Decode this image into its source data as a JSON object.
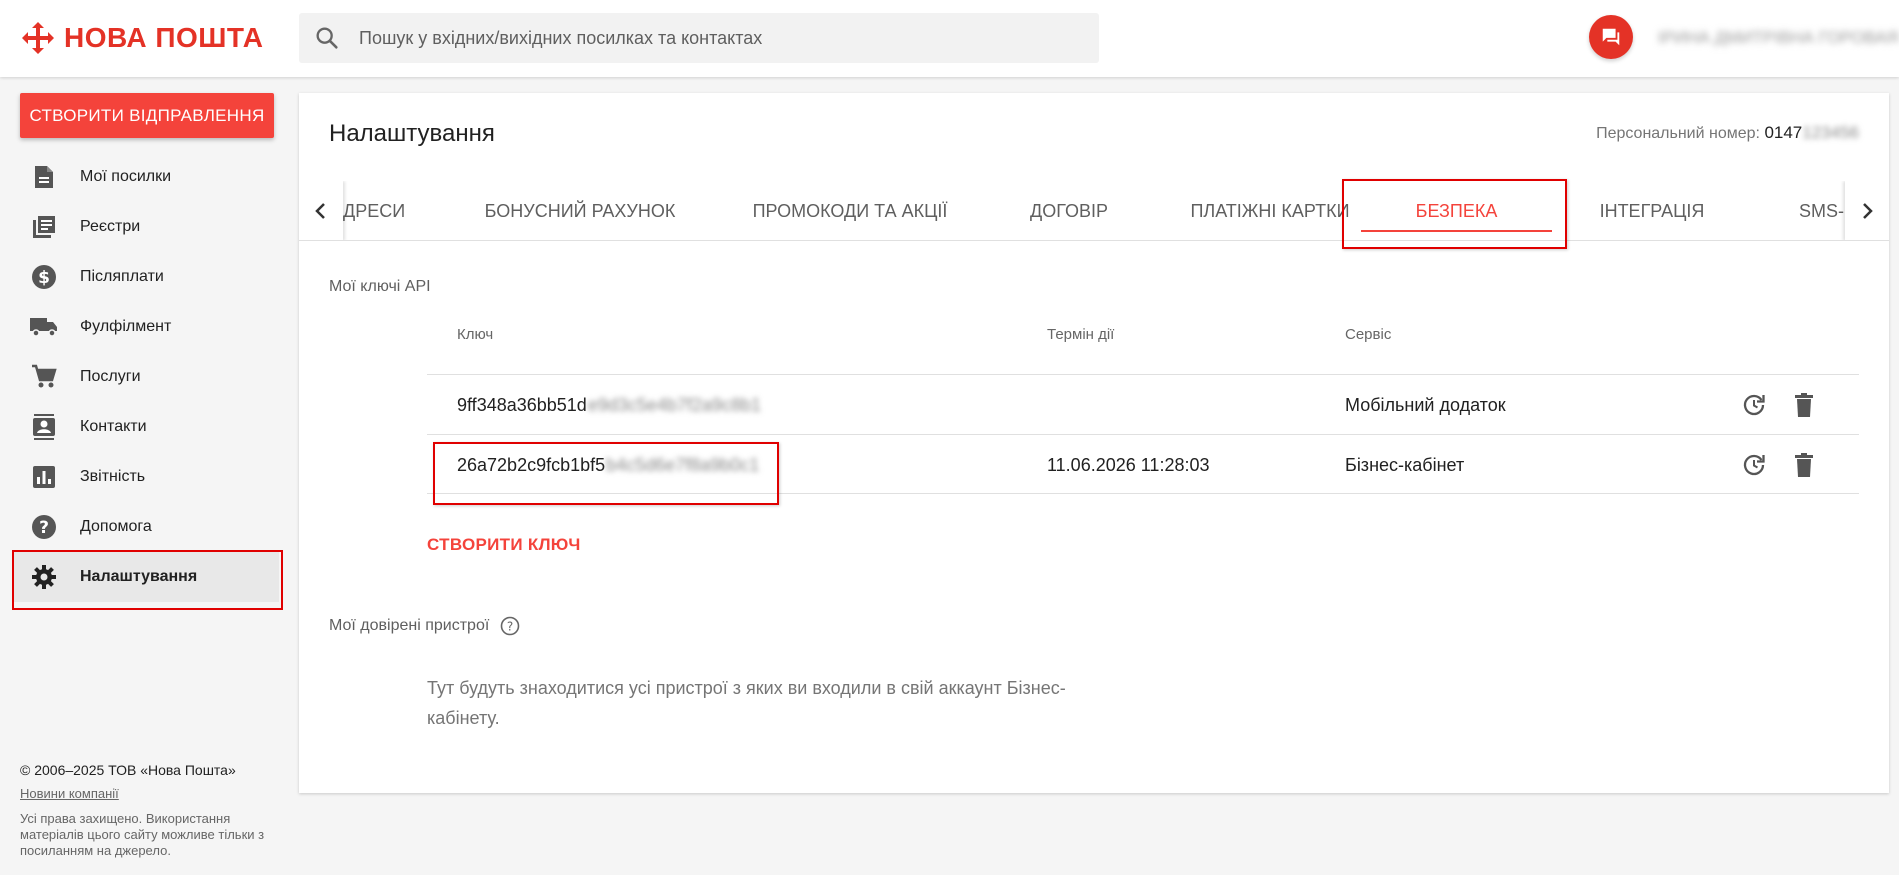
{
  "header": {
    "logo_text": "НОВА ПОШТА",
    "search_placeholder": "Пошук у вхідних/вихідних посилках та контактах",
    "user_name": "ІРИНА ДМИТРІВНА ГОРОВАЯ",
    "brand_color": "#e43226"
  },
  "sidebar": {
    "create_button": "СТВОРИТИ ВІДПРАВЛЕННЯ",
    "items": [
      {
        "label": "Мої посилки",
        "icon": "document-icon"
      },
      {
        "label": "Реєстри",
        "icon": "registry-icon"
      },
      {
        "label": "Післяплати",
        "icon": "dollar-icon"
      },
      {
        "label": "Фулфілмент",
        "icon": "truck-icon"
      },
      {
        "label": "Послуги",
        "icon": "cart-icon"
      },
      {
        "label": "Контакти",
        "icon": "contacts-icon"
      },
      {
        "label": "Звітність",
        "icon": "chart-icon"
      },
      {
        "label": "Допомога",
        "icon": "help-icon"
      },
      {
        "label": "Налаштування",
        "icon": "gear-icon",
        "active": true
      }
    ],
    "footer": {
      "copyright": "© 2006–2025 ТОВ «Нова Пошта»",
      "news_link": "Новини компанії",
      "rights": "Усі права захищено. Використання матеріалів цього сайту можливе тільки з посиланням на джерело."
    }
  },
  "main": {
    "title": "Налаштування",
    "personal_number_label": "Персональний номер:",
    "personal_number_visible": "0147",
    "personal_number_hidden": "123456",
    "tabs": [
      {
        "label": "ДРЕСИ"
      },
      {
        "label": "БОНУСНИЙ РАХУНОК"
      },
      {
        "label": "ПРОМОКОДИ ТА АКЦІЇ"
      },
      {
        "label": "ДОГОВІР"
      },
      {
        "label": "ПЛАТІЖНІ КАРТКИ"
      },
      {
        "label": "БЕЗПЕКА",
        "active": true
      },
      {
        "label": "ІНТЕГРАЦІЯ"
      },
      {
        "label": "SMS-"
      }
    ],
    "api_section": {
      "title": "Мої ключі API",
      "columns": [
        "Ключ",
        "Термін дії",
        "Сервіс"
      ],
      "rows": [
        {
          "key_visible": "9ff348a36bb51d",
          "key_hidden": "e9d3c5e4b7f2a9c8b1",
          "expiry": "",
          "service": "Мобільний додаток"
        },
        {
          "key_visible": "26a72b2c9fcb1bf5",
          "key_hidden": "b4c5d6e7f8a9b0c1",
          "expiry": "11.06.2026 11:28:03",
          "service": "Бізнес-кабінет"
        }
      ],
      "create_key": "СТВОРИТИ КЛЮЧ"
    },
    "devices_section": {
      "title": "Мої довірені пристрої",
      "note": "Тут будуть знаходитися усі пристрої з яких ви входили в свій аккаунт Бізнес-кабінету."
    }
  }
}
